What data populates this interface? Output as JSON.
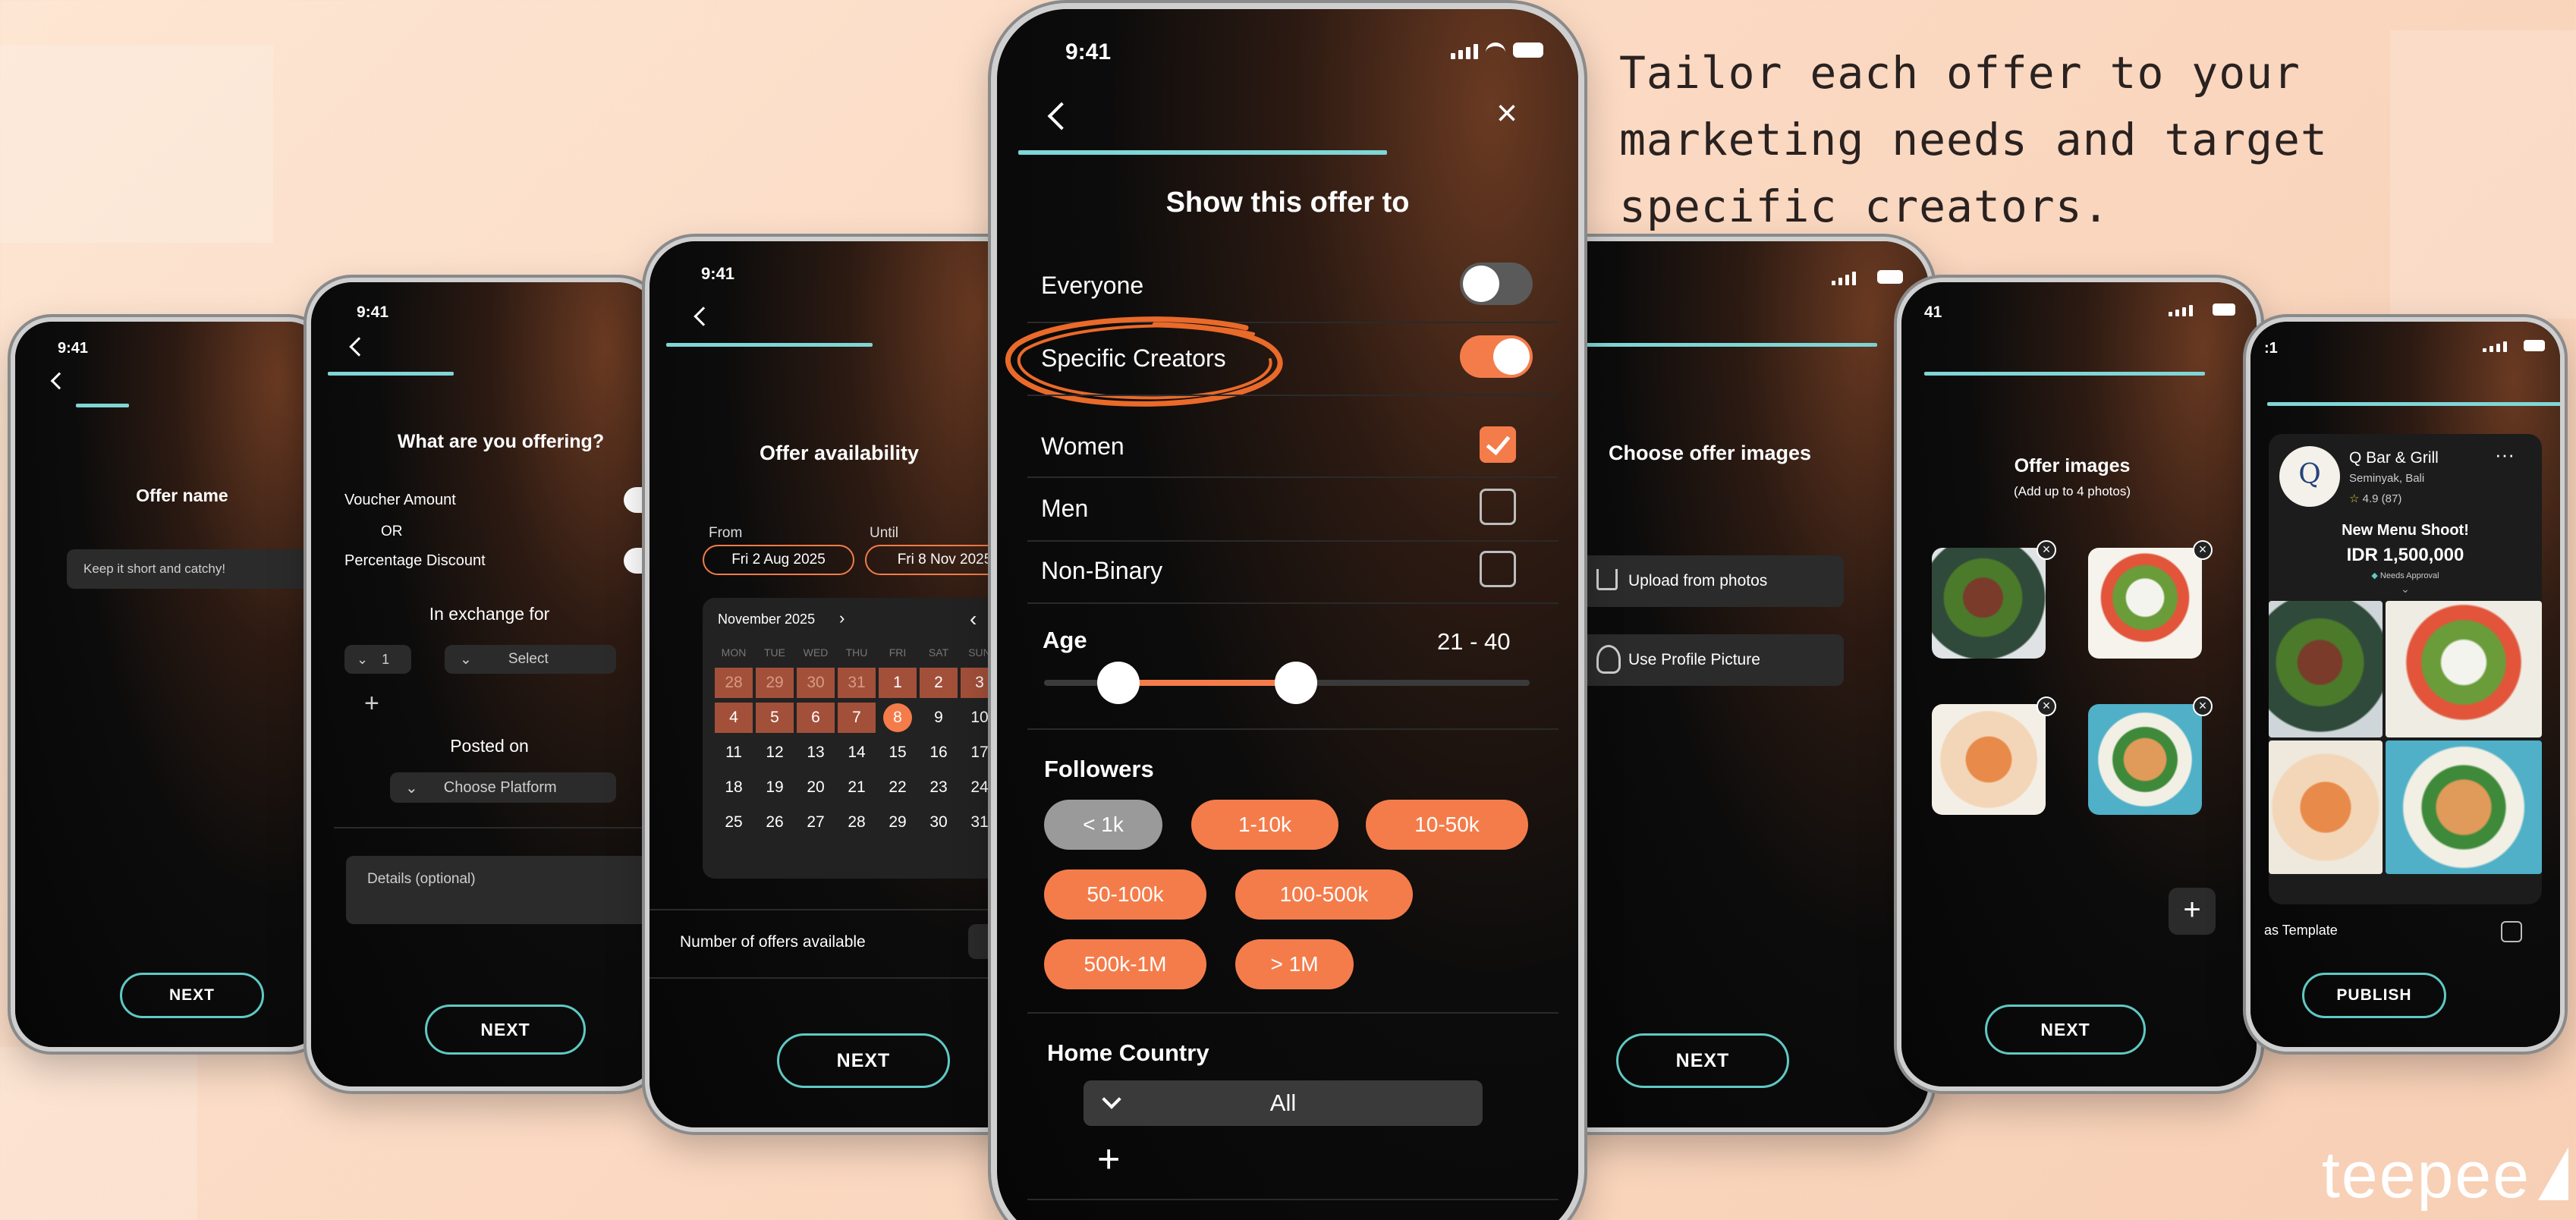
{
  "tagline": "Tailor each offer to your marketing needs and target specific creators.",
  "logo": "teepee",
  "status_time": "9:41",
  "phone1": {
    "title": "Offer name",
    "placeholder": "Keep it short and catchy!",
    "next": "NEXT"
  },
  "phone2": {
    "title": "What are you offering?",
    "voucher": "Voucher Amount",
    "or": "OR",
    "percentage": "Percentage Discount",
    "exchange": "In exchange for",
    "qty": "1",
    "select": "Select",
    "posted_on": "Posted on",
    "platform": "Choose Platform",
    "details": "Details (optional)",
    "next": "NEXT"
  },
  "phone3": {
    "title": "Offer availability",
    "from_label": "From",
    "until_label": "Until",
    "from_date": "Fri 2 Aug 2025",
    "until_date": "Fri 8 Nov 2025",
    "month": "November 2025",
    "weekdays": [
      "MON",
      "TUE",
      "WED",
      "THU",
      "FRI",
      "SAT",
      "SUN"
    ],
    "rows": [
      [
        "28",
        "29",
        "30",
        "31",
        "1",
        "2",
        "3"
      ],
      [
        "4",
        "5",
        "6",
        "7",
        "8",
        "9",
        "10"
      ],
      [
        "11",
        "12",
        "13",
        "14",
        "15",
        "16",
        "17"
      ],
      [
        "18",
        "19",
        "20",
        "21",
        "22",
        "23",
        "24"
      ],
      [
        "25",
        "26",
        "27",
        "28",
        "29",
        "30",
        "31"
      ]
    ],
    "offers_label": "Number of offers available",
    "next": "NEXT"
  },
  "phone4": {
    "title": "Show this offer to",
    "everyone": "Everyone",
    "specific": "Specific Creators",
    "women": "Women",
    "men": "Men",
    "nonbinary": "Non-Binary",
    "age_label": "Age",
    "age_value": "21 - 40",
    "age_min": 21,
    "age_max": 40,
    "followers_label": "Followers",
    "chips": [
      "< 1k",
      "1-10k",
      "10-50k",
      "50-100k",
      "100-500k",
      "500k-1M",
      "> 1M"
    ],
    "home_country": "Home Country",
    "country_value": "All",
    "add": "+"
  },
  "phone5": {
    "title": "Choose offer images",
    "upload": "Upload from photos",
    "profile": "Use Profile Picture",
    "next": "NEXT"
  },
  "phone6": {
    "title": "Offer images",
    "subtitle": "(Add up to 4 photos)",
    "next": "NEXT"
  },
  "phone7": {
    "venue": "Q Bar & Grill",
    "location": "Seminyak, Bali",
    "rating": "4.9 (87)",
    "offer_title": "New Menu Shoot!",
    "price": "IDR 1,500,000",
    "approval": "Needs Approval",
    "template": "as Template",
    "publish": "PUBLISH"
  },
  "colors": {
    "accent": "#f47c4a",
    "teal": "#5fc9c3",
    "progress": "#7fd6d6"
  }
}
